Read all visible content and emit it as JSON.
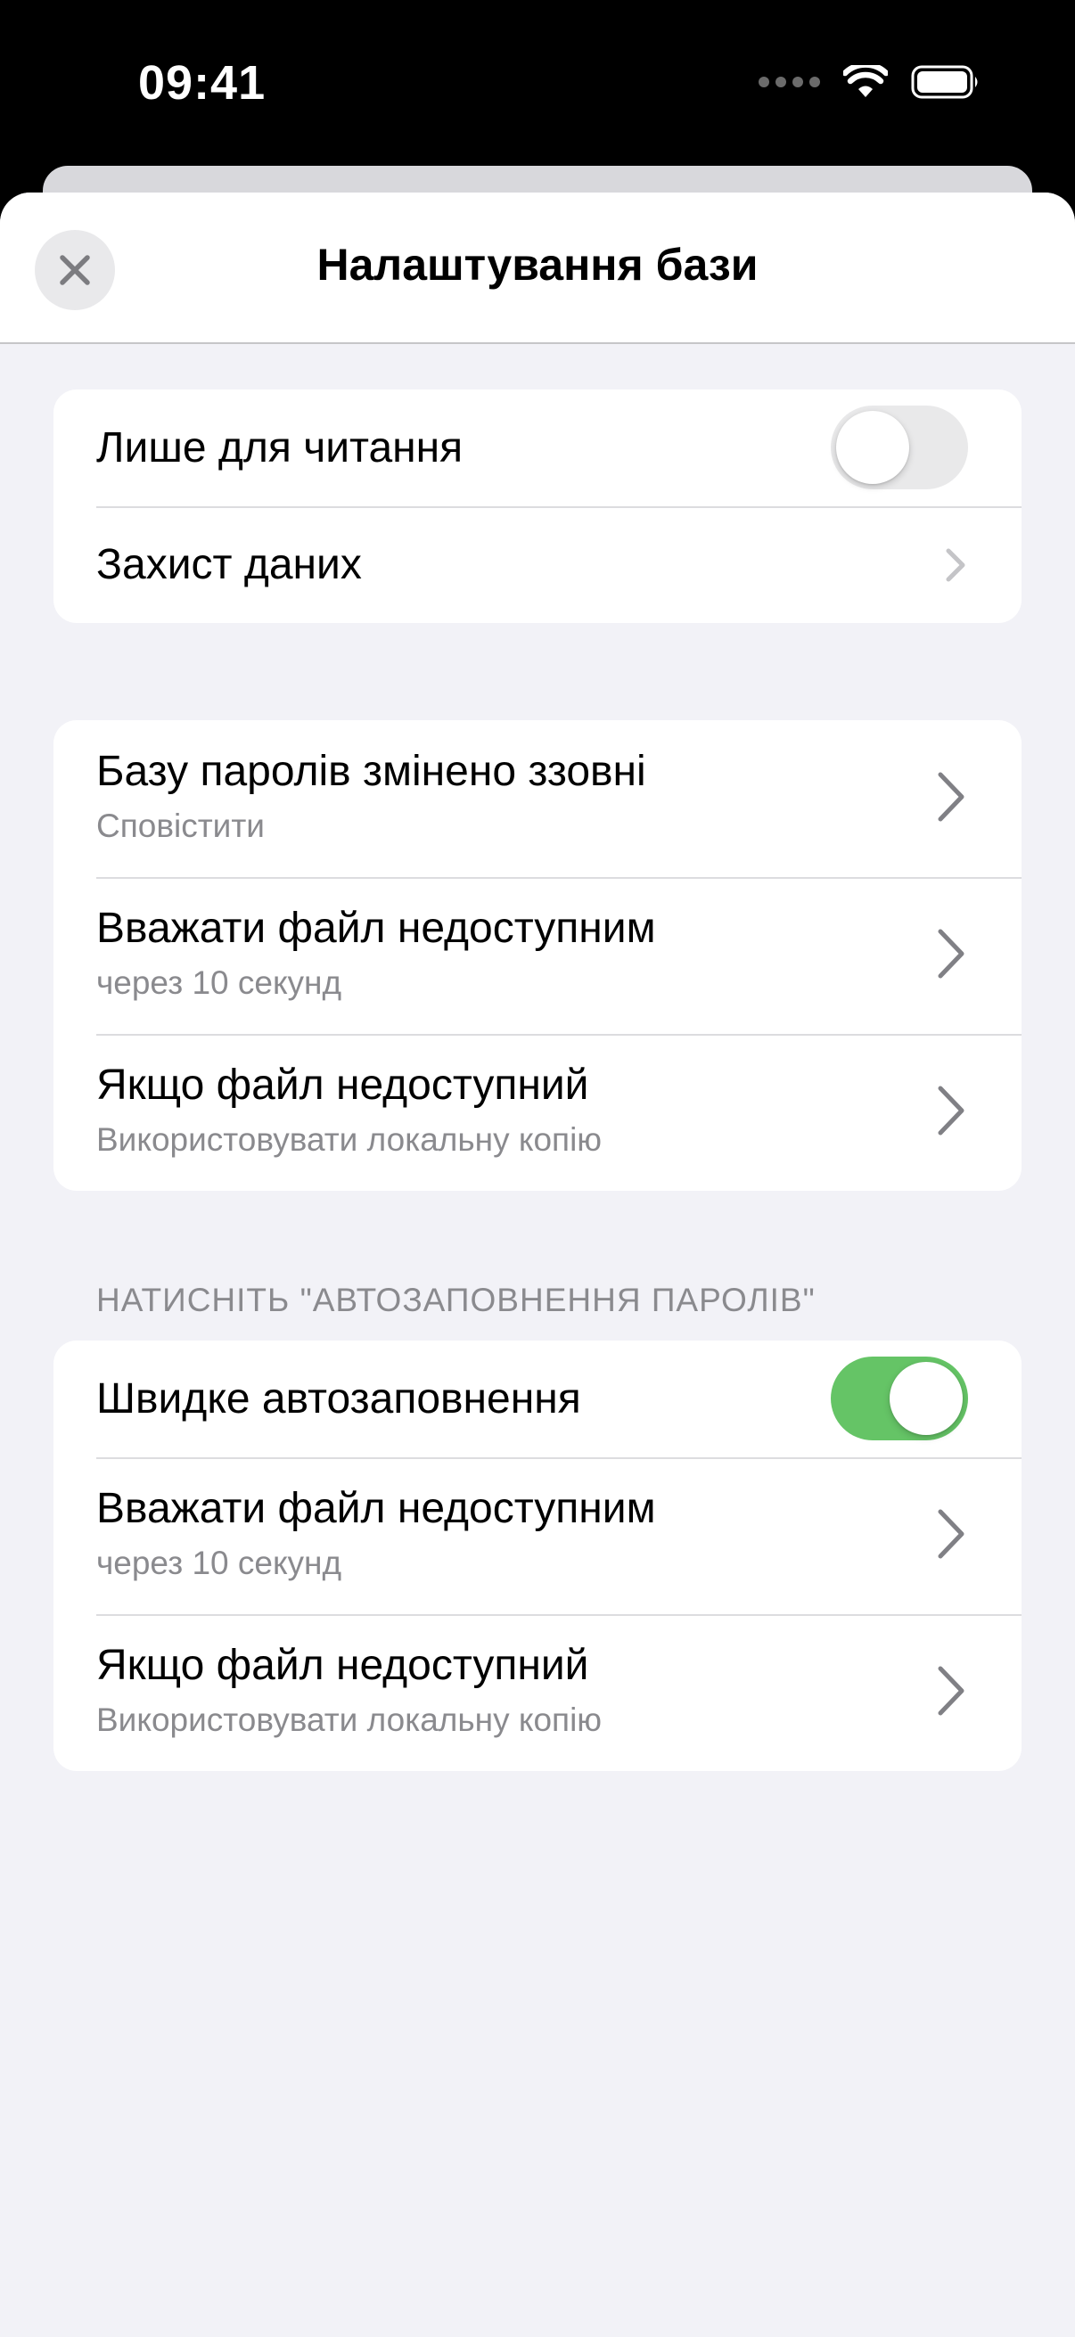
{
  "status_bar": {
    "time": "09:41",
    "icons": [
      "signal-icon",
      "wifi-icon",
      "battery-icon"
    ]
  },
  "nav": {
    "title": "Налаштування бази",
    "close_icon": "close-icon"
  },
  "group1": {
    "read_only": {
      "label": "Лише для читання",
      "toggle_on": false
    },
    "data_protection": {
      "label": "Захист даних"
    }
  },
  "group2": {
    "rows": [
      {
        "title": "Базу паролів змінено ззовні",
        "subtitle": "Сповістити"
      },
      {
        "title": "Вважати файл недоступним",
        "subtitle": "через 10 секунд"
      },
      {
        "title": "Якщо файл недоступний",
        "subtitle": "Використовувати локальну копію"
      }
    ]
  },
  "group3": {
    "header": "НАТИСНІТЬ \"АВТОЗАПОВНЕННЯ ПАРОЛІВ\"",
    "quick_autofill": {
      "label": "Швидке автозаповнення",
      "toggle_on": true
    },
    "rows": [
      {
        "title": "Вважати файл недоступним",
        "subtitle": "через 10 секунд"
      },
      {
        "title": "Якщо файл недоступний",
        "subtitle": "Використовувати локальну копію"
      }
    ]
  },
  "colors": {
    "toggle_on": "#65c466",
    "toggle_off": "#e9e9ea",
    "background": "#f2f2f7",
    "secondary_text": "#8a8a8e"
  }
}
